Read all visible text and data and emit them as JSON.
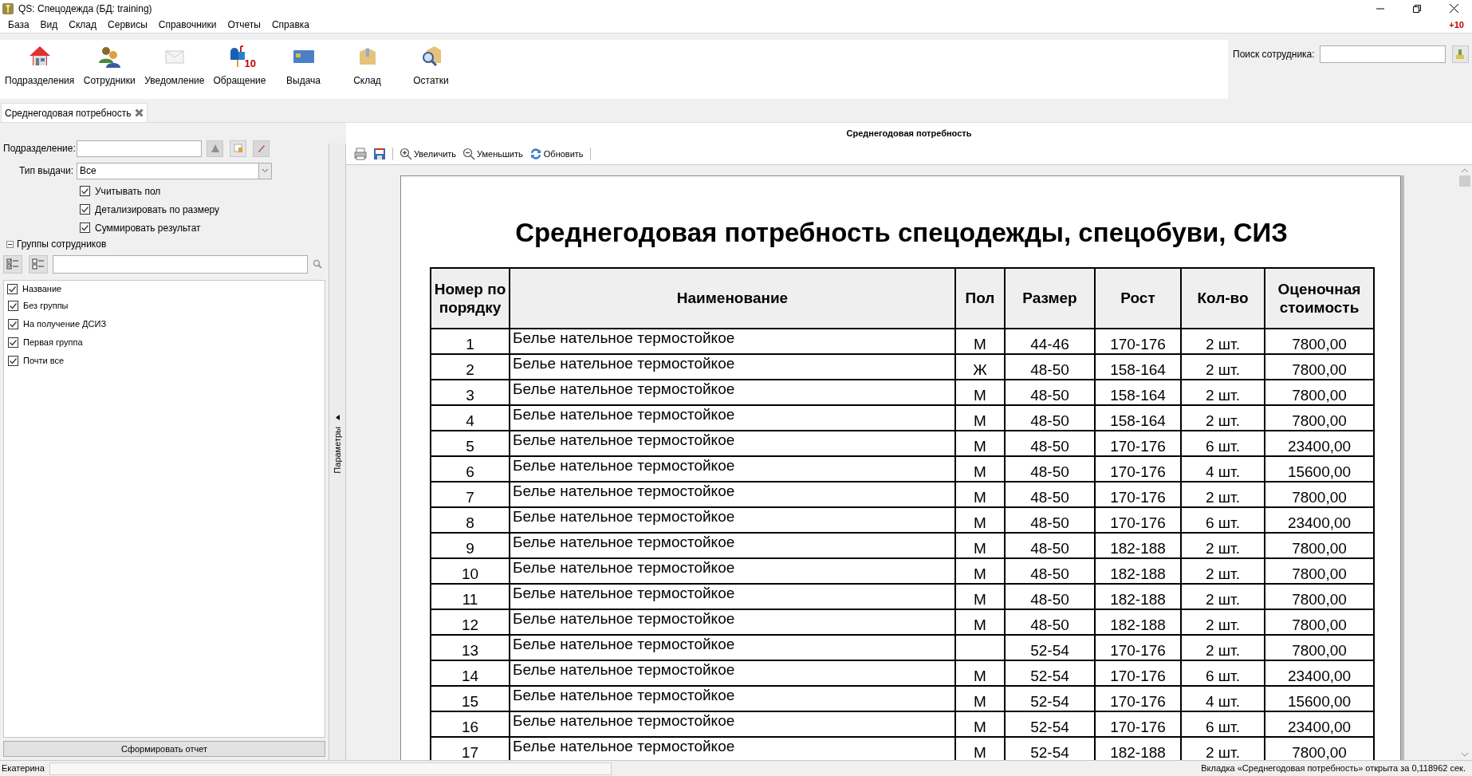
{
  "window": {
    "title": "QS: Спецодежда (БД: training)",
    "notice": "+10"
  },
  "menu": [
    "База",
    "Вид",
    "Склад",
    "Сервисы",
    "Справочники",
    "Отчеты",
    "Справка"
  ],
  "toolbar": [
    {
      "kind": "house",
      "label": "Подразделения"
    },
    {
      "kind": "people",
      "label": "Сотрудники"
    },
    {
      "kind": "envelope",
      "label": "Уведомление"
    },
    {
      "kind": "mailbox",
      "label": "Обращение",
      "badge": "10"
    },
    {
      "kind": "card",
      "label": "Выдача"
    },
    {
      "kind": "box",
      "label": "Склад"
    },
    {
      "kind": "magnifier",
      "label": "Остатки"
    }
  ],
  "employee_search": {
    "label": "Поиск сотрудника:"
  },
  "tabs": [
    {
      "label": "Среднегодовая потребность",
      "selected": true
    }
  ],
  "params": {
    "unit_label": "Подразделение:",
    "issue_type_label": "Тип выдачи:",
    "issue_type_value": "Все",
    "options": [
      {
        "label": "Учитывать пол",
        "checked": true
      },
      {
        "label": "Детализировать по размеру",
        "checked": true
      },
      {
        "label": "Суммировать результат",
        "checked": true
      }
    ],
    "groups": {
      "title": "Группы сотрудников",
      "expanded": true,
      "header": "Название",
      "header_checked": true,
      "items": [
        {
          "label": "Без группы",
          "checked": true
        },
        {
          "label": "На получение ДСИЗ",
          "checked": true
        },
        {
          "label": "Первая группа",
          "checked": true
        },
        {
          "label": "Почти все",
          "checked": true
        }
      ]
    },
    "button": "Сформировать отчет",
    "splitter_label": "Параметры"
  },
  "report": {
    "panel_title": "Среднегодовая потребность",
    "tools": [
      {
        "kind": "print"
      },
      {
        "kind": "save"
      },
      {
        "kind": "zoom-in",
        "label": "Увеличить"
      },
      {
        "kind": "zoom-out",
        "label": "Уменьшить"
      },
      {
        "kind": "refresh",
        "label": "Обновить"
      }
    ],
    "title": "Среднегодовая потребность спецодежды, спецобуви, СИЗ",
    "columns": [
      "Номер по порядку",
      "Наименование",
      "Пол",
      "Размер",
      "Рост",
      "Кол-во",
      "Оценочная стоимость"
    ],
    "rows": [
      [
        "1",
        "Белье нательное термостойкое",
        "М",
        "44-46",
        "170-176",
        "2 шт.",
        "7800,00"
      ],
      [
        "2",
        "Белье нательное термостойкое",
        "Ж",
        "48-50",
        "158-164",
        "2 шт.",
        "7800,00"
      ],
      [
        "3",
        "Белье нательное термостойкое",
        "М",
        "48-50",
        "158-164",
        "2 шт.",
        "7800,00"
      ],
      [
        "4",
        "Белье нательное термостойкое",
        "М",
        "48-50",
        "158-164",
        "2 шт.",
        "7800,00"
      ],
      [
        "5",
        "Белье нательное термостойкое",
        "М",
        "48-50",
        "170-176",
        "6 шт.",
        "23400,00"
      ],
      [
        "6",
        "Белье нательное термостойкое",
        "М",
        "48-50",
        "170-176",
        "4 шт.",
        "15600,00"
      ],
      [
        "7",
        "Белье нательное термостойкое",
        "М",
        "48-50",
        "170-176",
        "2 шт.",
        "7800,00"
      ],
      [
        "8",
        "Белье нательное термостойкое",
        "М",
        "48-50",
        "170-176",
        "6 шт.",
        "23400,00"
      ],
      [
        "9",
        "Белье нательное термостойкое",
        "М",
        "48-50",
        "182-188",
        "2 шт.",
        "7800,00"
      ],
      [
        "10",
        "Белье нательное термостойкое",
        "М",
        "48-50",
        "182-188",
        "2 шт.",
        "7800,00"
      ],
      [
        "11",
        "Белье нательное термостойкое",
        "М",
        "48-50",
        "182-188",
        "2 шт.",
        "7800,00"
      ],
      [
        "12",
        "Белье нательное термостойкое",
        "М",
        "48-50",
        "182-188",
        "2 шт.",
        "7800,00"
      ],
      [
        "13",
        "Белье нательное термостойкое",
        null,
        "52-54",
        "170-176",
        "2 шт.",
        "7800,00"
      ],
      [
        "14",
        "Белье нательное термостойкое",
        "М",
        "52-54",
        "170-176",
        "6 шт.",
        "23400,00"
      ],
      [
        "15",
        "Белье нательное термостойкое",
        "М",
        "52-54",
        "170-176",
        "4 шт.",
        "15600,00"
      ],
      [
        "16",
        "Белье нательное термостойкое",
        "М",
        "52-54",
        "170-176",
        "6 шт.",
        "23400,00"
      ],
      [
        "17",
        "Белье нательное термостойкое",
        "М",
        "52-54",
        "182-188",
        "2 шт.",
        "7800,00"
      ]
    ]
  },
  "status_bar": {
    "user": "Екатерина",
    "message": "Вкладка «Среднегодовая потребность» открыта за 0,118962 сек."
  }
}
